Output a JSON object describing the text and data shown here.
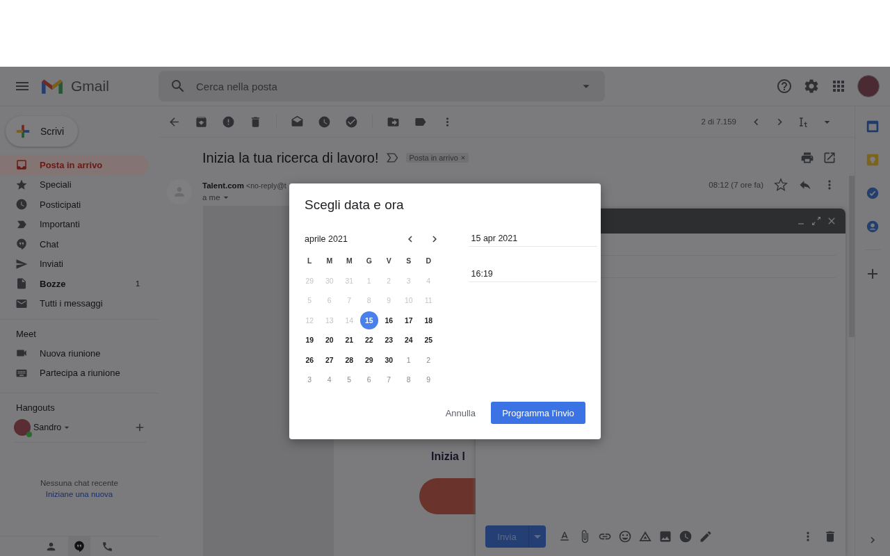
{
  "header": {
    "app_name": "Gmail",
    "search": {
      "placeholder": "Cerca nella posta"
    }
  },
  "sidebar": {
    "compose": "Scrivi",
    "items": [
      {
        "label": "Posta in arrivo",
        "selected": true,
        "bold": true
      },
      {
        "label": "Speciali",
        "selected": false,
        "bold": false
      },
      {
        "label": "Posticipati",
        "selected": false,
        "bold": false
      },
      {
        "label": "Importanti",
        "selected": false,
        "bold": false
      },
      {
        "label": "Chat",
        "selected": false,
        "bold": false
      },
      {
        "label": "Inviati",
        "selected": false,
        "bold": false
      },
      {
        "label": "Bozze",
        "selected": false,
        "bold": true,
        "count": "1"
      },
      {
        "label": "Tutti i messaggi",
        "selected": false,
        "bold": false
      }
    ],
    "meet": {
      "title": "Meet",
      "items": [
        "Nuova riunione",
        "Partecipa a riunione"
      ]
    },
    "hangouts": {
      "title": "Hangouts",
      "user": "Sandro",
      "online": true,
      "empty_text": "Nessuna chat recente",
      "start_link": "Iniziane una nuova"
    }
  },
  "toolbar": {
    "counter": "2 di 7.159"
  },
  "email": {
    "subject": "Inizia la tua ricerca di lavoro!",
    "label": "Posta in arrivo",
    "sender": "Talent.com",
    "sender_email": "<no-reply@t",
    "recipient": "a me",
    "time": "08:12 (7 ore fa)",
    "body_heading": "Inizia l"
  },
  "compose": {
    "send": "Invia"
  },
  "dialog": {
    "title": "Scegli data e ora",
    "month": "aprile 2021",
    "weekdays": [
      "L",
      "M",
      "M",
      "G",
      "V",
      "S",
      "D"
    ],
    "weeks": [
      [
        {
          "label": "29",
          "kind": "past",
          "selected": false
        },
        {
          "label": "30",
          "kind": "past",
          "selected": false
        },
        {
          "label": "31",
          "kind": "past",
          "selected": false
        },
        {
          "label": "1",
          "kind": "past",
          "selected": false
        },
        {
          "label": "2",
          "kind": "past",
          "selected": false
        },
        {
          "label": "3",
          "kind": "past",
          "selected": false
        },
        {
          "label": "4",
          "kind": "past",
          "selected": false
        }
      ],
      [
        {
          "label": "5",
          "kind": "past",
          "selected": false
        },
        {
          "label": "6",
          "kind": "past",
          "selected": false
        },
        {
          "label": "7",
          "kind": "past",
          "selected": false
        },
        {
          "label": "8",
          "kind": "past",
          "selected": false
        },
        {
          "label": "9",
          "kind": "past",
          "selected": false
        },
        {
          "label": "10",
          "kind": "past",
          "selected": false
        },
        {
          "label": "11",
          "kind": "past",
          "selected": false
        }
      ],
      [
        {
          "label": "12",
          "kind": "past",
          "selected": false
        },
        {
          "label": "13",
          "kind": "past",
          "selected": false
        },
        {
          "label": "14",
          "kind": "past",
          "selected": false
        },
        {
          "label": "15",
          "kind": "current",
          "selected": true
        },
        {
          "label": "16",
          "kind": "current",
          "selected": false
        },
        {
          "label": "17",
          "kind": "current",
          "selected": false
        },
        {
          "label": "18",
          "kind": "current",
          "selected": false
        }
      ],
      [
        {
          "label": "19",
          "kind": "current",
          "selected": false
        },
        {
          "label": "20",
          "kind": "current",
          "selected": false
        },
        {
          "label": "21",
          "kind": "current",
          "selected": false
        },
        {
          "label": "22",
          "kind": "current",
          "selected": false
        },
        {
          "label": "23",
          "kind": "current",
          "selected": false
        },
        {
          "label": "24",
          "kind": "current",
          "selected": false
        },
        {
          "label": "25",
          "kind": "current",
          "selected": false
        }
      ],
      [
        {
          "label": "26",
          "kind": "current",
          "selected": false
        },
        {
          "label": "27",
          "kind": "current",
          "selected": false
        },
        {
          "label": "28",
          "kind": "current",
          "selected": false
        },
        {
          "label": "29",
          "kind": "current",
          "selected": false
        },
        {
          "label": "30",
          "kind": "current",
          "selected": false
        },
        {
          "label": "1",
          "kind": "next",
          "selected": false
        },
        {
          "label": "2",
          "kind": "next",
          "selected": false
        }
      ],
      [
        {
          "label": "3",
          "kind": "next",
          "selected": false
        },
        {
          "label": "4",
          "kind": "next",
          "selected": false
        },
        {
          "label": "5",
          "kind": "next",
          "selected": false
        },
        {
          "label": "6",
          "kind": "next",
          "selected": false
        },
        {
          "label": "7",
          "kind": "next",
          "selected": false
        },
        {
          "label": "8",
          "kind": "next",
          "selected": false
        },
        {
          "label": "9",
          "kind": "next",
          "selected": false
        }
      ]
    ],
    "date": "15 apr 2021",
    "time": "16:19",
    "cancel": "Annulla",
    "confirm": "Programma l'invio"
  }
}
